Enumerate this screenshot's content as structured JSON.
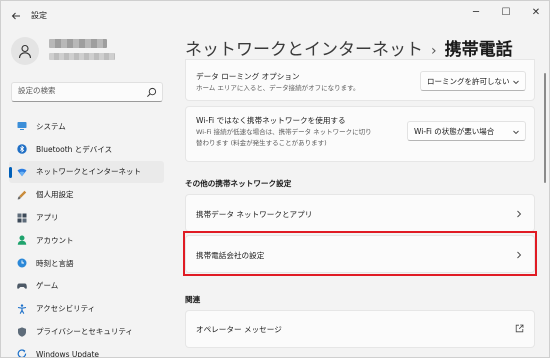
{
  "window": {
    "title": "設定",
    "controls": {
      "minimize": "─",
      "maximize": "☐",
      "close": "✕"
    }
  },
  "search": {
    "placeholder": "設定の検索"
  },
  "sidebar": {
    "items": [
      {
        "label": "システム",
        "icon": "system-icon",
        "active": false
      },
      {
        "label": "Bluetooth とデバイス",
        "icon": "bluetooth-icon",
        "active": false
      },
      {
        "label": "ネットワークとインターネット",
        "icon": "network-icon",
        "active": true
      },
      {
        "label": "個人用設定",
        "icon": "personalization-icon",
        "active": false
      },
      {
        "label": "アプリ",
        "icon": "apps-icon",
        "active": false
      },
      {
        "label": "アカウント",
        "icon": "account-icon",
        "active": false
      },
      {
        "label": "時刻と言語",
        "icon": "time-language-icon",
        "active": false
      },
      {
        "label": "ゲーム",
        "icon": "gaming-icon",
        "active": false
      },
      {
        "label": "アクセシビリティ",
        "icon": "accessibility-icon",
        "active": false
      },
      {
        "label": "プライバシーとセキュリティ",
        "icon": "privacy-icon",
        "active": false
      },
      {
        "label": "Windows Update",
        "icon": "windows-update-icon",
        "active": false
      }
    ]
  },
  "breadcrumb": {
    "parent": "ネットワークとインターネット",
    "separator": "›",
    "current": "携帯電話"
  },
  "settings": {
    "roaming": {
      "title": "データ ローミング オプション",
      "desc": "ホーム エリアに入ると、データ接続がオフになります。",
      "value": "ローミングを許可しない"
    },
    "wifi_instead": {
      "title": "Wi-Fi ではなく携帯ネットワークを使用する",
      "desc_line1": "Wi-Fi 接続が低速な場合は、携帯データ ネットワークに切り",
      "desc_line2": "替わります (料金が発生することがあります)",
      "value": "Wi-Fi の状態が悪い場合"
    }
  },
  "sections": {
    "other": {
      "title": "その他の携帯ネットワーク設定",
      "items": [
        "携帯データ ネットワークとアプリ",
        "携帯電話会社の設定"
      ]
    },
    "related": {
      "title": "関連",
      "items": [
        "オペレーター メッセージ"
      ]
    }
  },
  "colors": {
    "accent": "#005fb8",
    "highlight": "#e01b24"
  }
}
